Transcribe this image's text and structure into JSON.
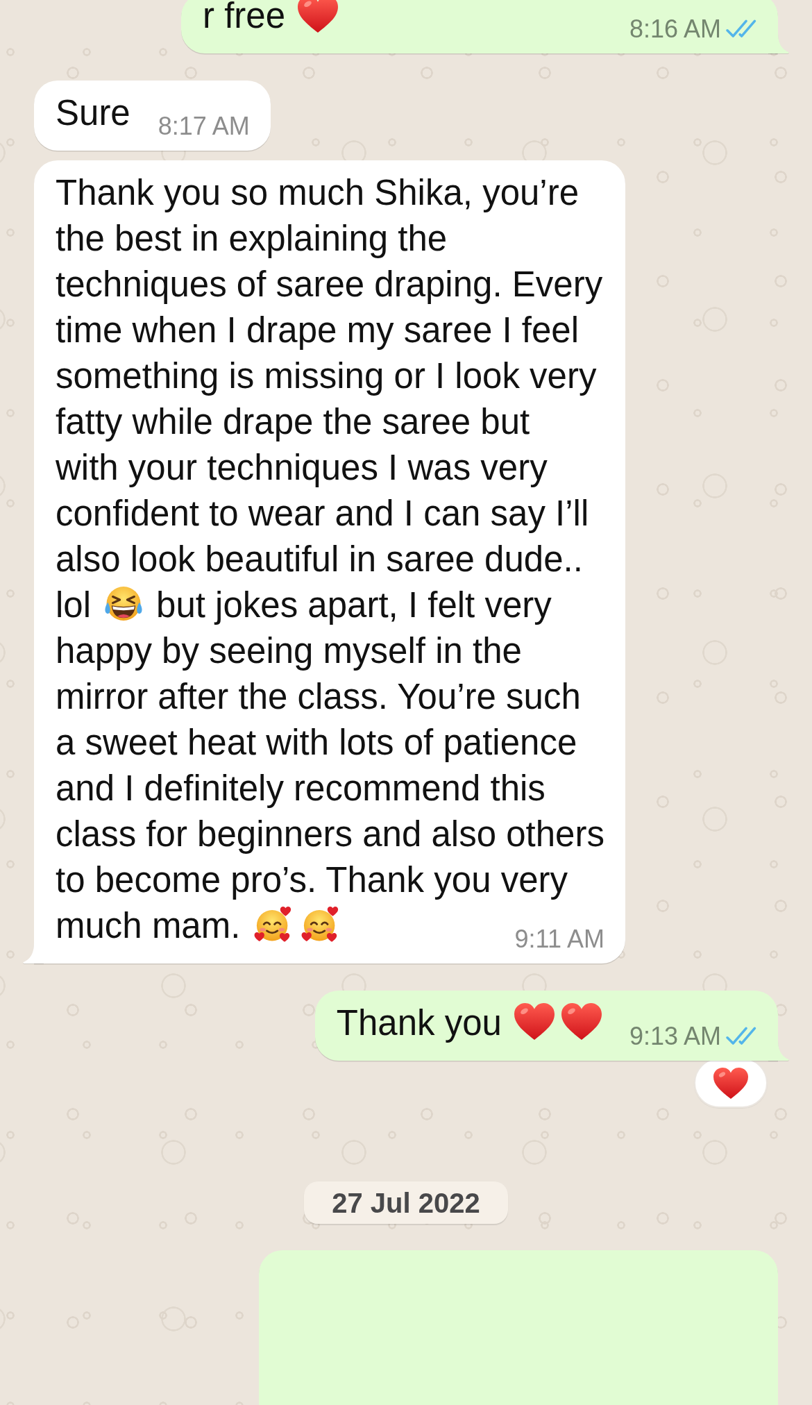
{
  "chat": {
    "items": [
      {
        "kind": "message",
        "outgoing": true,
        "tail": true,
        "blocks": [
          {
            "parts": [
              {
                "kind": "text",
                "text": "r free"
              },
              {
                "kind": "heart"
              }
            ]
          }
        ],
        "time": "8:16 AM",
        "read": true
      },
      {
        "kind": "message",
        "outgoing": false,
        "tail": false,
        "blocks": [
          {
            "parts": [
              {
                "kind": "text",
                "text": "Sure"
              }
            ]
          }
        ],
        "time": "8:17 AM"
      },
      {
        "kind": "message",
        "outgoing": false,
        "tail": true,
        "blocks": [
          {
            "parts": [
              {
                "kind": "text",
                "text": "Thank you so much Shika, you’re\nthe best in explaining the\ntechniques of saree draping. Every\ntime when I drape my saree I feel\nsomething is missing or I look very\nfatty while drape the saree but\nwith your techniques I was very\nconfident to wear and I can say I’ll\nalso look beautiful in saree dude.."
              }
            ]
          },
          {
            "parts": [
              {
                "kind": "text",
                "text": "lol"
              },
              {
                "kind": "laughing"
              },
              {
                "kind": "text",
                "text": "but jokes apart, I felt very"
              }
            ]
          },
          {
            "parts": [
              {
                "kind": "text",
                "text": "happy by seeing myself in the\nmirror after the class. You’re such\na sweet heat with lots of patience\nand I definitely recommend this\nclass for beginners and also others\nto become pro’s. Thank you very"
              }
            ]
          },
          {
            "parts": [
              {
                "kind": "text",
                "text": "much mam."
              },
              {
                "kind": "loving"
              },
              {
                "kind": "loving"
              }
            ]
          }
        ],
        "time": "9:11 AM"
      },
      {
        "kind": "message",
        "outgoing": true,
        "tail": true,
        "blocks": [
          {
            "parts": [
              {
                "kind": "text",
                "text": "Thank you"
              },
              {
                "kind": "heart"
              },
              {
                "kind": "heart"
              }
            ]
          }
        ],
        "time": "9:13 AM",
        "read": true,
        "reaction": {
          "kind": "heart"
        }
      },
      {
        "kind": "date",
        "text": "27 Jul 2022"
      },
      {
        "kind": "blank",
        "outgoing": true
      }
    ]
  }
}
